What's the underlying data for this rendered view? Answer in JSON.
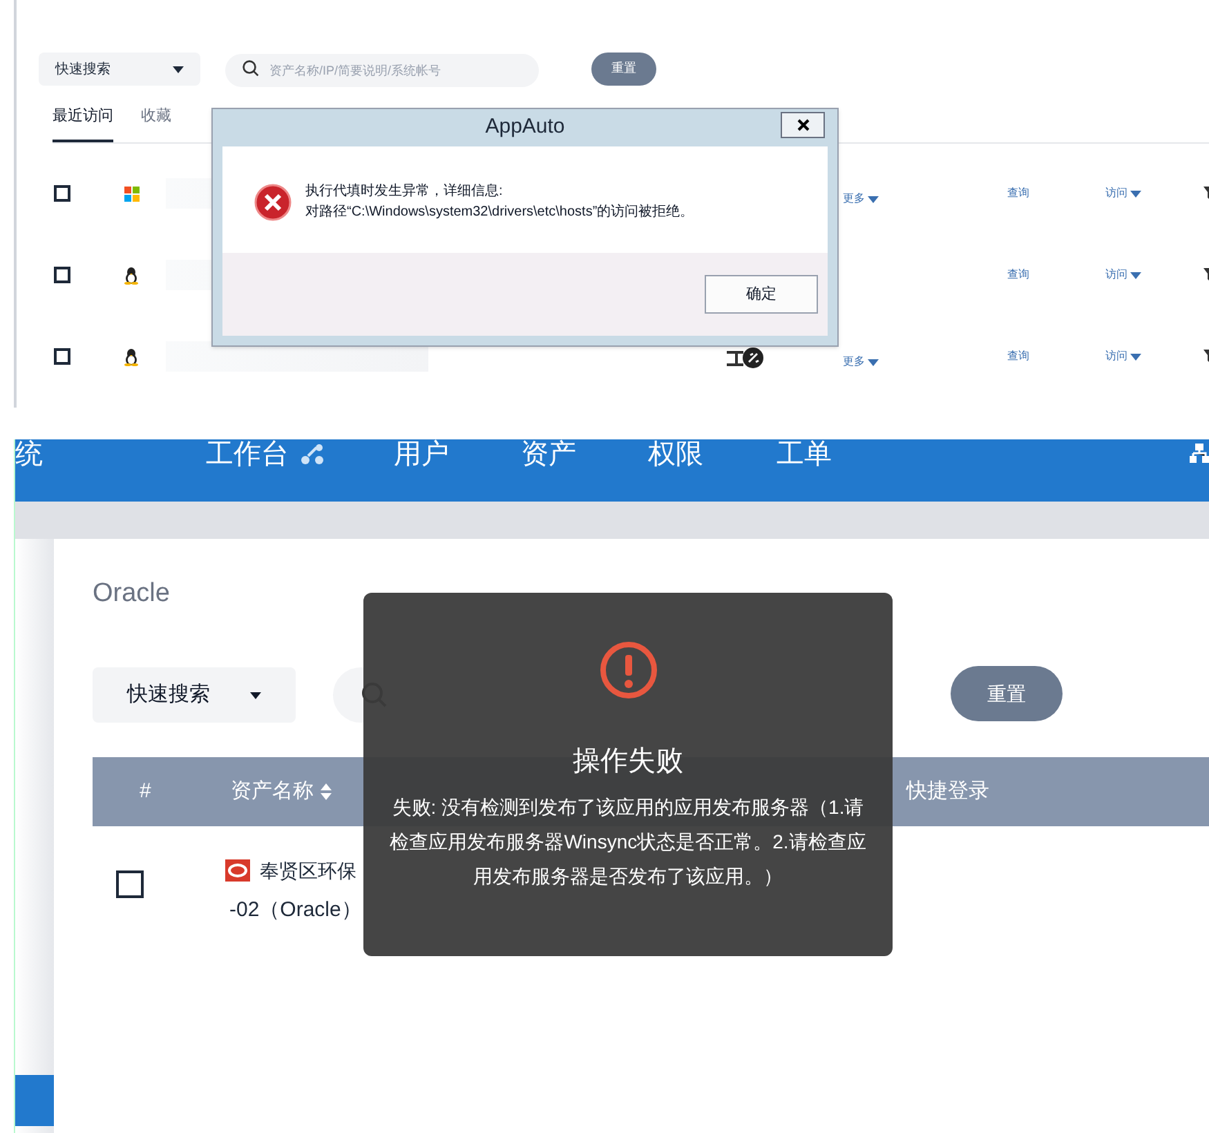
{
  "top_panel": {
    "quick_search": "快速搜索",
    "search": {
      "placeholder": "资产名称/IP/简要说明/系统帐号"
    },
    "reset_button": "重置",
    "tabs": [
      {
        "label": "最近访问",
        "selected": true
      },
      {
        "label": "收藏",
        "selected": false
      }
    ],
    "rows": [
      {
        "kind": "windows",
        "checked": false,
        "remote_desktop": false,
        "more": "更多",
        "query": "查询",
        "visit": "访问"
      },
      {
        "kind": "linux",
        "checked": false,
        "remote_desktop": false,
        "query": "查询",
        "visit": "访问"
      },
      {
        "kind": "linux",
        "checked": false,
        "remote_desktop": true,
        "more": "更多",
        "query": "查询",
        "visit": "访问"
      }
    ],
    "dialog": {
      "title": "AppAuto",
      "message": [
        "执行代填时发生异常，详细信息:",
        "对路径“C:\\Windows\\system32\\drivers\\etc\\hosts”的访问被拒绝。"
      ],
      "ok_button": "确定"
    }
  },
  "bottom_panel": {
    "nav": [
      {
        "label": "统",
        "icon": false
      },
      {
        "label": "工作台",
        "icon": true
      },
      {
        "label": "用户",
        "icon": false
      },
      {
        "label": "资产",
        "icon": false
      },
      {
        "label": "权限",
        "icon": false
      },
      {
        "label": "工单",
        "icon": false
      }
    ],
    "title": "Oracle",
    "quick_search": "快速搜索",
    "reset_button": "重置",
    "table": {
      "columns": [
        {
          "label": "#",
          "sortable": false
        },
        {
          "label": "资产名称",
          "sortable": true
        },
        {
          "label": "快捷登录",
          "sortable": false
        }
      ],
      "rows": [
        {
          "checked": false,
          "name": "奉贤区环保",
          "name_line2": "-02（Oracle）"
        }
      ]
    },
    "toast": {
      "title": "操作失败",
      "message": "失败: 没有检测到发布了该应用的应用发布服务器（1.请检查应用发布服务器Winsync状态是否正常。2.请检查应用发布服务器是否发布了该应用。）"
    }
  }
}
